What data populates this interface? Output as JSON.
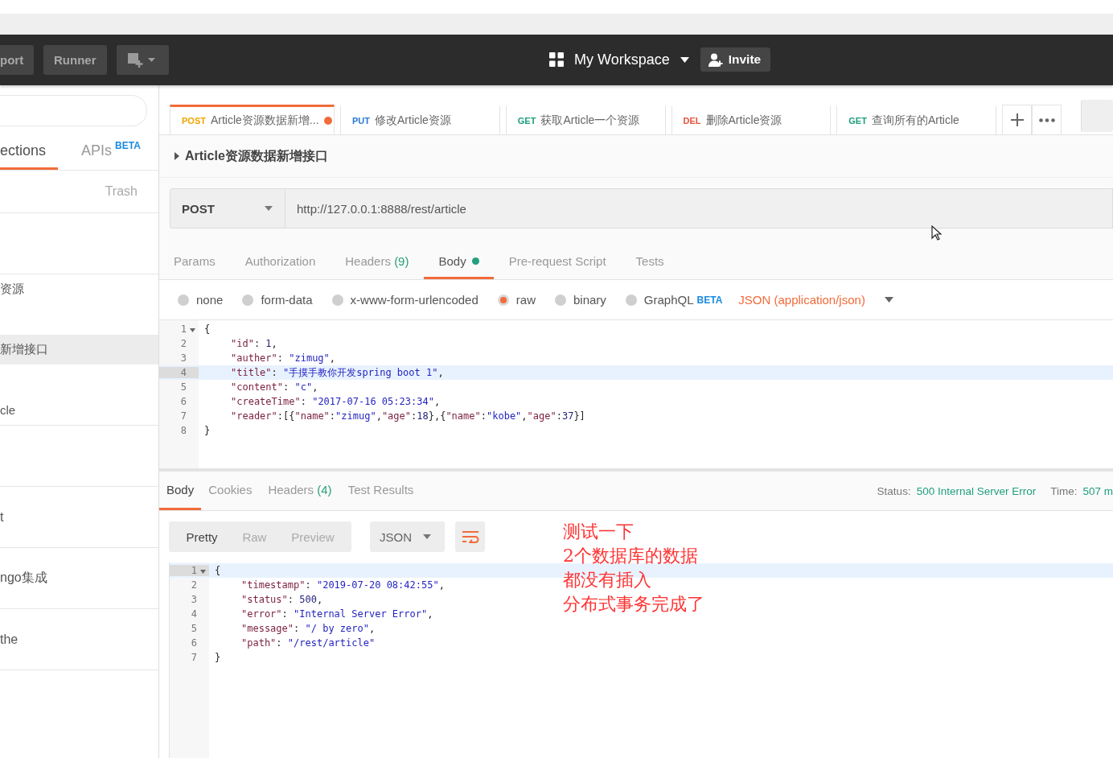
{
  "header": {
    "buttons": [
      {
        "label": "port"
      },
      {
        "label": "Runner"
      }
    ],
    "workspace": "My Workspace",
    "invite": "Invite"
  },
  "sidebar": {
    "tabs": [
      {
        "label": "ections",
        "selected": true
      },
      {
        "label": "APIs",
        "badge": "BETA",
        "selected": false
      }
    ],
    "trash": "Trash",
    "requests": [
      {
        "label": "资源",
        "selected": false
      },
      {
        "label": "新增接口",
        "selected": true
      },
      {
        "label": "cle",
        "selected": false
      }
    ],
    "folders": [
      {
        "label": "t"
      },
      {
        "label": "ngo集成"
      },
      {
        "label": "the"
      }
    ]
  },
  "tabs": [
    {
      "method": "POST",
      "color": "#f0a500",
      "label": "Article资源数据新增...",
      "selected": true,
      "unsaved": true
    },
    {
      "method": "PUT",
      "color": "#2b7ad6",
      "label": "修改Article资源",
      "selected": false,
      "unsaved": false
    },
    {
      "method": "GET",
      "color": "#1d9c7c",
      "label": "获取Article一个资源",
      "selected": false,
      "unsaved": false
    },
    {
      "method": "DEL",
      "color": "#e5533c",
      "label": "删除Article资源",
      "selected": false,
      "unsaved": false
    },
    {
      "method": "GET",
      "color": "#1d9c7c",
      "label": "查询所有的Article",
      "selected": false,
      "unsaved": false
    }
  ],
  "request": {
    "name": "Article资源数据新增接口",
    "method": "POST",
    "url": "http://127.0.0.1:8888/rest/article",
    "tabs": [
      {
        "label": "Params",
        "selected": false
      },
      {
        "label": "Authorization",
        "selected": false
      },
      {
        "label": "Headers",
        "count": "(9)",
        "selected": false
      },
      {
        "label": "Body",
        "has_content": true,
        "selected": true
      },
      {
        "label": "Pre-request Script",
        "selected": false
      },
      {
        "label": "Tests",
        "selected": false
      }
    ],
    "body_modes": [
      {
        "label": "none",
        "selected": false
      },
      {
        "label": "form-data",
        "selected": false
      },
      {
        "label": "x-www-form-urlencoded",
        "selected": false
      },
      {
        "label": "raw",
        "selected": true
      },
      {
        "label": "binary",
        "selected": false
      },
      {
        "label": "GraphQL",
        "badge": "BETA",
        "selected": false
      }
    ],
    "content_type": "JSON (application/json)",
    "lines": [
      {
        "num": "1",
        "foldable": true,
        "indented": false,
        "active": false,
        "tokens": [
          {
            "kind": "punc",
            "text": "{"
          }
        ]
      },
      {
        "num": "2",
        "foldable": false,
        "indented": true,
        "active": false,
        "tokens": [
          {
            "kind": "key",
            "text": "\"id\""
          },
          {
            "kind": "punc",
            "text": ": "
          },
          {
            "kind": "num",
            "text": "1"
          },
          {
            "kind": "punc",
            "text": ","
          }
        ]
      },
      {
        "num": "3",
        "foldable": false,
        "indented": true,
        "active": false,
        "tokens": [
          {
            "kind": "key",
            "text": "\"auther\""
          },
          {
            "kind": "punc",
            "text": ": "
          },
          {
            "kind": "str",
            "text": "\"zimug\""
          },
          {
            "kind": "punc",
            "text": ","
          }
        ]
      },
      {
        "num": "4",
        "foldable": false,
        "indented": true,
        "active": true,
        "tokens": [
          {
            "kind": "key",
            "text": "\"title\""
          },
          {
            "kind": "punc",
            "text": ": "
          },
          {
            "kind": "str",
            "text": "\"手摸手教你开发spring boot 1\""
          },
          {
            "kind": "punc",
            "text": ","
          }
        ]
      },
      {
        "num": "5",
        "foldable": false,
        "indented": true,
        "active": false,
        "tokens": [
          {
            "kind": "key",
            "text": "\"content\""
          },
          {
            "kind": "punc",
            "text": ": "
          },
          {
            "kind": "str",
            "text": "\"c\""
          },
          {
            "kind": "punc",
            "text": ","
          }
        ]
      },
      {
        "num": "6",
        "foldable": false,
        "indented": true,
        "active": false,
        "tokens": [
          {
            "kind": "key",
            "text": "\"createTime\""
          },
          {
            "kind": "punc",
            "text": ": "
          },
          {
            "kind": "str",
            "text": "\"2017-07-16 05:23:34\""
          },
          {
            "kind": "punc",
            "text": ","
          }
        ]
      },
      {
        "num": "7",
        "foldable": false,
        "indented": true,
        "active": false,
        "tokens": [
          {
            "kind": "key",
            "text": "\"reader\""
          },
          {
            "kind": "punc",
            "text": ":[{"
          },
          {
            "kind": "key",
            "text": "\"name\""
          },
          {
            "kind": "punc",
            "text": ":"
          },
          {
            "kind": "str",
            "text": "\"zimug\""
          },
          {
            "kind": "punc",
            "text": ","
          },
          {
            "kind": "key",
            "text": "\"age\""
          },
          {
            "kind": "punc",
            "text": ":"
          },
          {
            "kind": "num",
            "text": "18"
          },
          {
            "kind": "punc",
            "text": "},{"
          },
          {
            "kind": "key",
            "text": "\"name\""
          },
          {
            "kind": "punc",
            "text": ":"
          },
          {
            "kind": "str",
            "text": "\"kobe\""
          },
          {
            "kind": "punc",
            "text": ","
          },
          {
            "kind": "key",
            "text": "\"age\""
          },
          {
            "kind": "punc",
            "text": ":"
          },
          {
            "kind": "num",
            "text": "37"
          },
          {
            "kind": "punc",
            "text": "}]"
          }
        ]
      },
      {
        "num": "8",
        "foldable": false,
        "indented": false,
        "active": false,
        "tokens": [
          {
            "kind": "punc",
            "text": "}"
          }
        ]
      }
    ]
  },
  "response": {
    "tabs": [
      {
        "label": "Body",
        "selected": true
      },
      {
        "label": "Cookies",
        "selected": false
      },
      {
        "label": "Headers",
        "count": "(4)",
        "selected": false
      },
      {
        "label": "Test Results",
        "selected": false
      }
    ],
    "status_label": "Status:",
    "status": "500 Internal Server Error",
    "time_label": "Time:",
    "time": "507 m",
    "views": [
      {
        "label": "Pretty",
        "selected": true
      },
      {
        "label": "Raw",
        "selected": false
      },
      {
        "label": "Preview",
        "selected": false
      }
    ],
    "format": "JSON",
    "wrap": true,
    "lines": [
      {
        "num": "1",
        "foldable": true,
        "indented": false,
        "active": true,
        "tokens": [
          {
            "kind": "punc",
            "text": "{"
          }
        ]
      },
      {
        "num": "2",
        "foldable": false,
        "indented": true,
        "active": false,
        "tokens": [
          {
            "kind": "key",
            "text": "\"timestamp\""
          },
          {
            "kind": "punc",
            "text": ": "
          },
          {
            "kind": "str",
            "text": "\"2019-07-20 08:42:55\""
          },
          {
            "kind": "punc",
            "text": ","
          }
        ]
      },
      {
        "num": "3",
        "foldable": false,
        "indented": true,
        "active": false,
        "tokens": [
          {
            "kind": "key",
            "text": "\"status\""
          },
          {
            "kind": "punc",
            "text": ": "
          },
          {
            "kind": "num",
            "text": "500"
          },
          {
            "kind": "punc",
            "text": ","
          }
        ]
      },
      {
        "num": "4",
        "foldable": false,
        "indented": true,
        "active": false,
        "tokens": [
          {
            "kind": "key",
            "text": "\"error\""
          },
          {
            "kind": "punc",
            "text": ": "
          },
          {
            "kind": "str",
            "text": "\"Internal Server Error\""
          },
          {
            "kind": "punc",
            "text": ","
          }
        ]
      },
      {
        "num": "5",
        "foldable": false,
        "indented": true,
        "active": false,
        "tokens": [
          {
            "kind": "key",
            "text": "\"message\""
          },
          {
            "kind": "punc",
            "text": ": "
          },
          {
            "kind": "str",
            "text": "\"/ by zero\""
          },
          {
            "kind": "punc",
            "text": ","
          }
        ]
      },
      {
        "num": "6",
        "foldable": false,
        "indented": true,
        "active": false,
        "tokens": [
          {
            "kind": "key",
            "text": "\"path\""
          },
          {
            "kind": "punc",
            "text": ": "
          },
          {
            "kind": "str",
            "text": "\"/rest/article\""
          }
        ]
      },
      {
        "num": "7",
        "foldable": false,
        "indented": false,
        "active": false,
        "tokens": [
          {
            "kind": "punc",
            "text": "}"
          }
        ]
      }
    ]
  },
  "annotation": [
    "测试一下",
    "2个数据库的数据",
    "都没有插入",
    "分布式事务完成了"
  ]
}
